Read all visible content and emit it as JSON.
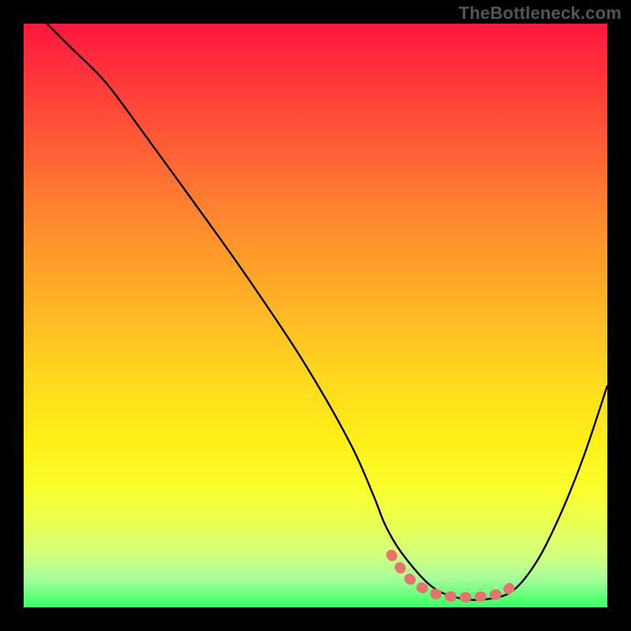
{
  "watermark": "TheBottleneck.com",
  "chart_data": {
    "type": "line",
    "title": "",
    "xlabel": "",
    "ylabel": "",
    "xlim": [
      0,
      100
    ],
    "ylim": [
      0,
      100
    ],
    "grid": false,
    "series": [
      {
        "name": "black-curve",
        "color": "#000000",
        "x": [
          4,
          8,
          14,
          20,
          28,
          38,
          48,
          56,
          60,
          62,
          65,
          70,
          75,
          80,
          84,
          88,
          92,
          96,
          100
        ],
        "y": [
          100,
          96,
          90,
          82,
          71,
          57,
          42,
          28,
          19,
          14,
          9,
          3.5,
          1.5,
          1.5,
          3,
          8,
          16,
          26,
          38
        ]
      },
      {
        "name": "highlighted-minimum",
        "color": "#e6736e",
        "x": [
          63,
          66,
          70,
          74,
          78,
          82,
          84
        ],
        "y": [
          9,
          5,
          2.5,
          1.8,
          1.8,
          2.5,
          4
        ]
      }
    ],
    "annotations": [
      {
        "type": "background-gradient",
        "direction": "vertical",
        "stops": [
          {
            "pos": 0.0,
            "color": "#ff153f"
          },
          {
            "pos": 0.2,
            "color": "#ff5a36"
          },
          {
            "pos": 0.48,
            "color": "#ffb326"
          },
          {
            "pos": 0.72,
            "color": "#fff018"
          },
          {
            "pos": 0.91,
            "color": "#d2ff7c"
          },
          {
            "pos": 1.0,
            "color": "#37ff66"
          }
        ]
      }
    ]
  }
}
